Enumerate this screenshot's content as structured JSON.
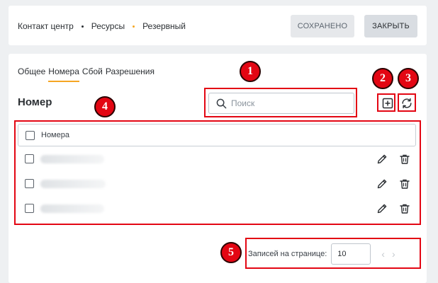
{
  "colors": {
    "accent": "#f5a623",
    "annotation": "#e30613",
    "crumb_dot_resources": "#2b2f33",
    "crumb_dot_reserve": "#f5a623"
  },
  "header": {
    "breadcrumbs": [
      "Контакт центр",
      "Ресурсы",
      "Резервный"
    ],
    "saved_label": "СОХРАНЕНО",
    "close_label": "ЗАКРЫТЬ"
  },
  "tabs": [
    {
      "label": "Общее",
      "active": false
    },
    {
      "label": "Номера",
      "active": true
    },
    {
      "label": "Сбой",
      "active": false
    },
    {
      "label": "Разрешения",
      "active": false
    }
  ],
  "section": {
    "title": "Номер",
    "search_placeholder": "Поиск",
    "add_icon": "plus-square-icon",
    "refresh_icon": "refresh-icon"
  },
  "table": {
    "column_header": "Номера",
    "rows": [
      {
        "value_hidden": true,
        "edit_icon": "pencil-icon",
        "delete_icon": "trash-icon"
      },
      {
        "value_hidden": true,
        "edit_icon": "pencil-icon",
        "delete_icon": "trash-icon"
      },
      {
        "value_hidden": true,
        "edit_icon": "pencil-icon",
        "delete_icon": "trash-icon"
      }
    ]
  },
  "pager": {
    "label": "Записей на странице:",
    "page_size": "10"
  },
  "annotations": [
    "1",
    "2",
    "3",
    "4",
    "5"
  ]
}
